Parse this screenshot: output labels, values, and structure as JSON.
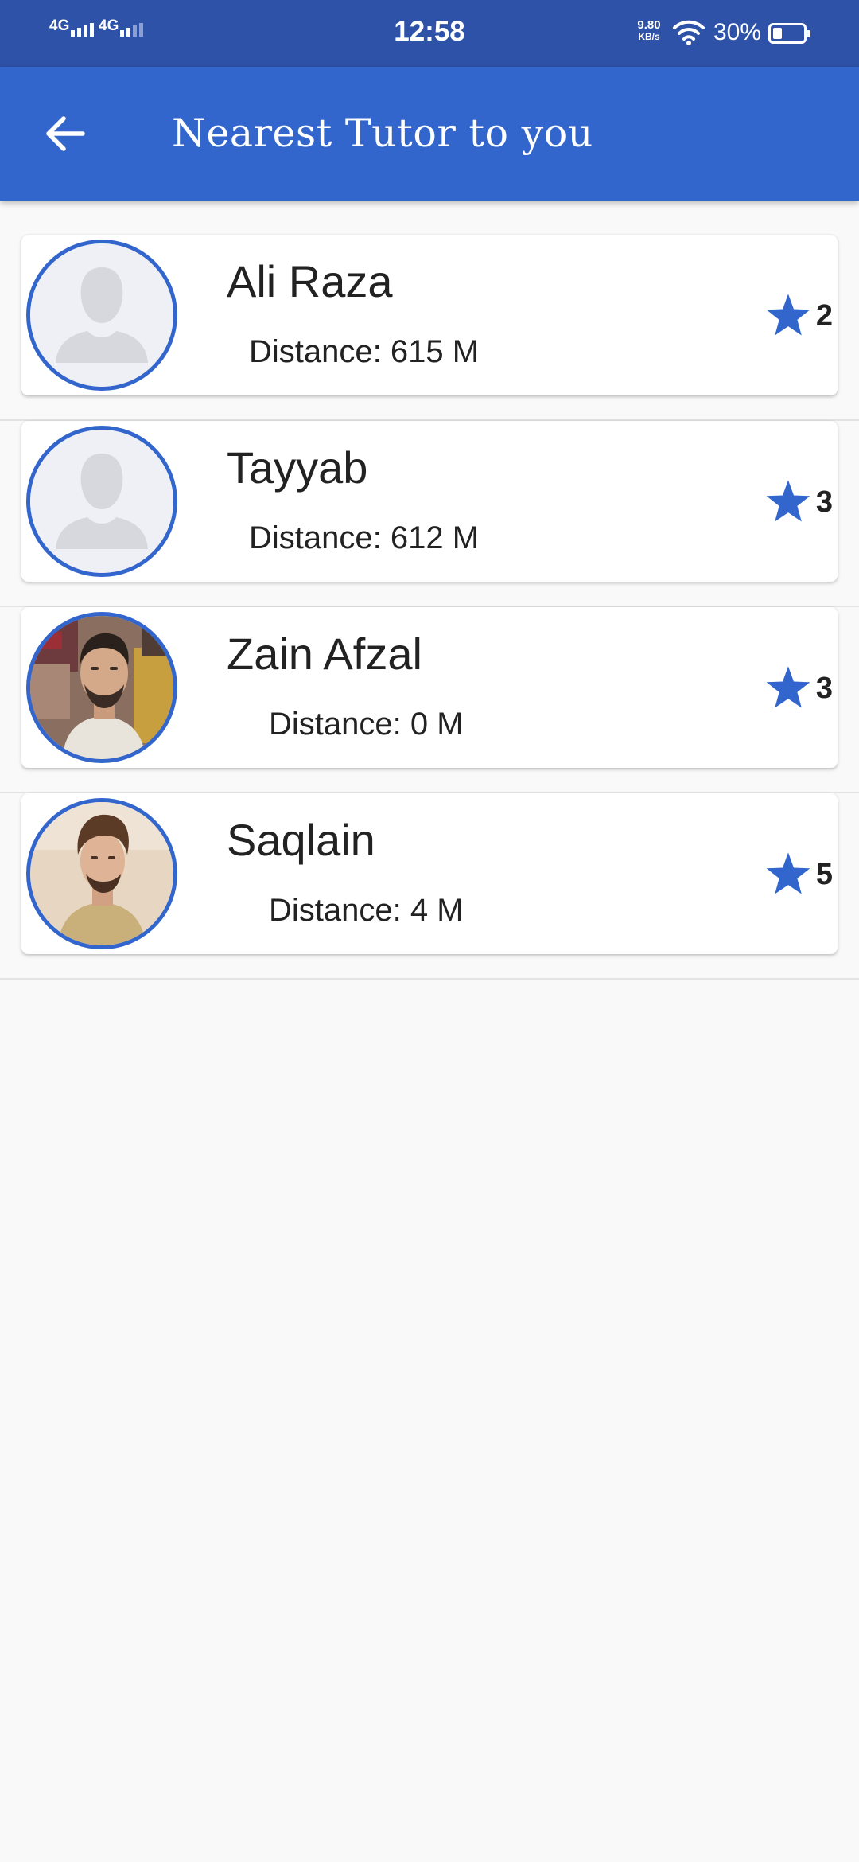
{
  "status_bar": {
    "network_1": "4G",
    "network_2": "4G",
    "time": "12:58",
    "speed_value": "9.80",
    "speed_unit": "KB/s",
    "battery_percent": "30%",
    "battery_level": 0.3
  },
  "app_bar": {
    "title": "Nearest Tutor to you",
    "back_icon": "arrow-left-icon",
    "background": "#3366cc"
  },
  "tutors": [
    {
      "name": "Ali Raza",
      "distance": "Distance: 615 M",
      "rating": "2",
      "avatar": "placeholder-person-icon"
    },
    {
      "name": "Tayyab",
      "distance": "Distance: 612 M",
      "rating": "3",
      "avatar": "placeholder-person-icon"
    },
    {
      "name": "Zain Afzal",
      "distance": "Distance: 0 M",
      "rating": "3",
      "avatar": "photo"
    },
    {
      "name": "Saqlain",
      "distance": "Distance: 4 M",
      "rating": "5",
      "avatar": "photo"
    }
  ],
  "colors": {
    "accent": "#3366cc",
    "status_bar": "#2d52a8",
    "star": "#3366cc"
  }
}
